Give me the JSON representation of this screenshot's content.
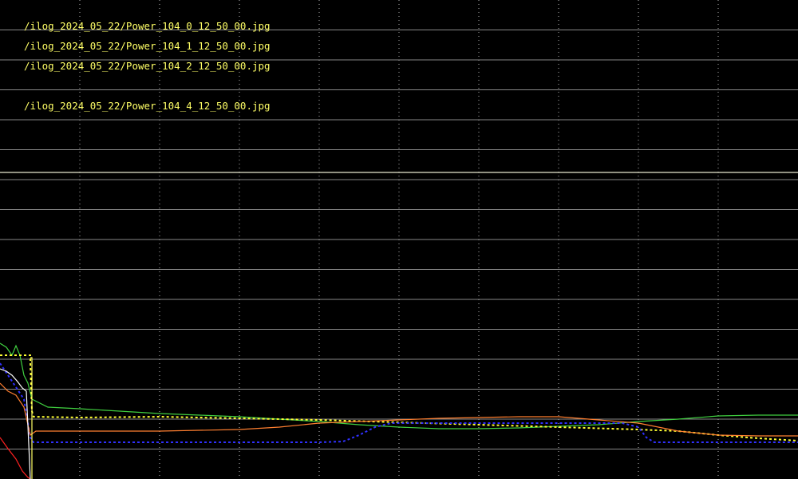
{
  "chart_data": {
    "type": "line",
    "title": "",
    "xlabel": "",
    "ylabel": "",
    "background": "#000000",
    "grid": {
      "vertical": "dotted",
      "horizontal": "solid",
      "color": "#ffffff"
    },
    "file_labels": [
      "/ilog_2024_05_22/Power_104_0_12_50_00.jpg",
      "/ilog_2024_05_22/Power_104_1_12_50_00.jpg",
      "/ilog_2024_05_22/Power_104_2_12_50_00.jpg",
      "/ilog_2024_05_22/Power_104_4_12_50_00.jpg"
    ],
    "label_color": "#ffff66",
    "series": [
      {
        "color": "#e8e8d0",
        "style": "solid",
        "values": [
          [
            0,
            216
          ],
          [
            100,
            216
          ],
          [
            200,
            216
          ],
          [
            300,
            216
          ],
          [
            400,
            216
          ],
          [
            500,
            216
          ],
          [
            600,
            216
          ],
          [
            700,
            216
          ],
          [
            800,
            216
          ],
          [
            900,
            216
          ],
          [
            1000,
            216
          ]
        ]
      },
      {
        "color": "#40d040",
        "style": "solid",
        "values": [
          [
            0,
            430
          ],
          [
            8,
            435
          ],
          [
            15,
            445
          ],
          [
            20,
            433
          ],
          [
            25,
            445
          ],
          [
            30,
            470
          ],
          [
            35,
            480
          ],
          [
            40,
            500
          ],
          [
            60,
            510
          ],
          [
            100,
            512
          ],
          [
            150,
            515
          ],
          [
            200,
            518
          ],
          [
            250,
            520
          ],
          [
            300,
            522
          ],
          [
            350,
            525
          ],
          [
            400,
            528
          ],
          [
            450,
            532
          ],
          [
            500,
            535
          ],
          [
            550,
            537
          ],
          [
            600,
            537
          ],
          [
            650,
            536
          ],
          [
            700,
            534
          ],
          [
            750,
            532
          ],
          [
            800,
            528
          ],
          [
            850,
            525
          ],
          [
            900,
            521
          ],
          [
            950,
            520
          ],
          [
            1000,
            520
          ]
        ]
      },
      {
        "color": "#ffff33",
        "style": "dotted",
        "values": [
          [
            0,
            445
          ],
          [
            38,
            445
          ],
          [
            38,
            455
          ],
          [
            40,
            515
          ],
          [
            42,
            522
          ],
          [
            100,
            523
          ],
          [
            200,
            522
          ],
          [
            300,
            524
          ],
          [
            400,
            526
          ],
          [
            500,
            529
          ],
          [
            600,
            532
          ],
          [
            700,
            535
          ],
          [
            800,
            538
          ],
          [
            850,
            540
          ],
          [
            900,
            545
          ],
          [
            950,
            549
          ],
          [
            1000,
            552
          ]
        ]
      },
      {
        "color": "#3030ff",
        "style": "dotted",
        "values": [
          [
            0,
            455
          ],
          [
            30,
            500
          ],
          [
            38,
            548
          ],
          [
            42,
            554
          ],
          [
            100,
            554
          ],
          [
            200,
            554
          ],
          [
            300,
            554
          ],
          [
            400,
            554
          ],
          [
            430,
            553
          ],
          [
            450,
            545
          ],
          [
            470,
            535
          ],
          [
            490,
            530
          ],
          [
            520,
            530
          ],
          [
            600,
            530
          ],
          [
            700,
            530
          ],
          [
            780,
            530
          ],
          [
            800,
            535
          ],
          [
            810,
            548
          ],
          [
            820,
            554
          ],
          [
            900,
            554
          ],
          [
            1000,
            554
          ]
        ]
      },
      {
        "color": "#ff7f30",
        "style": "solid",
        "values": [
          [
            0,
            480
          ],
          [
            10,
            490
          ],
          [
            20,
            495
          ],
          [
            30,
            510
          ],
          [
            38,
            545
          ],
          [
            45,
            540
          ],
          [
            100,
            540
          ],
          [
            200,
            540
          ],
          [
            300,
            538
          ],
          [
            350,
            535
          ],
          [
            400,
            530
          ],
          [
            450,
            528
          ],
          [
            500,
            526
          ],
          [
            550,
            524
          ],
          [
            600,
            523
          ],
          [
            650,
            522
          ],
          [
            700,
            522
          ],
          [
            750,
            526
          ],
          [
            800,
            530
          ],
          [
            850,
            540
          ],
          [
            900,
            545
          ],
          [
            950,
            546
          ],
          [
            1000,
            546
          ]
        ]
      },
      {
        "color": "#ff2020",
        "style": "solid",
        "values": [
          [
            0,
            548
          ],
          [
            10,
            562
          ],
          [
            20,
            575
          ],
          [
            28,
            590
          ],
          [
            35,
            598
          ],
          [
            38,
            600
          ]
        ]
      },
      {
        "color": "#ffffff",
        "style": "solid",
        "values": [
          [
            0,
            462
          ],
          [
            8,
            465
          ],
          [
            15,
            470
          ],
          [
            22,
            478
          ],
          [
            28,
            486
          ],
          [
            33,
            490
          ],
          [
            38,
            600
          ]
        ]
      },
      {
        "color": "#ffff66",
        "style": "solid",
        "values": [
          [
            38,
            448
          ],
          [
            40,
            448
          ],
          [
            40,
            600
          ]
        ]
      }
    ]
  }
}
